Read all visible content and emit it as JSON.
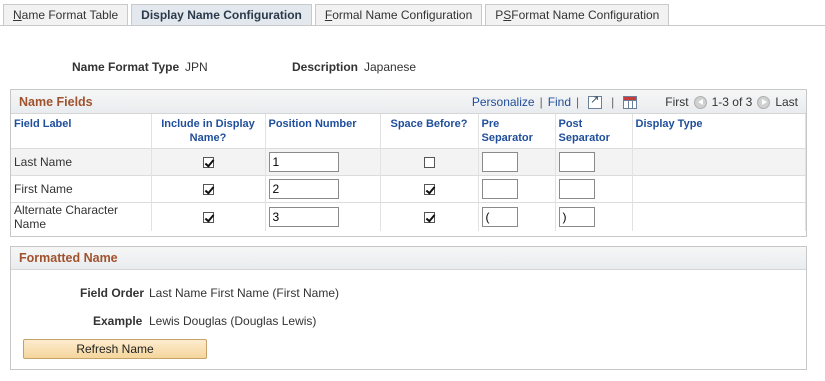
{
  "tabs": [
    {
      "label": "Name Format Table",
      "active": false
    },
    {
      "label": "Display Name Configuration",
      "active": true
    },
    {
      "label": "Formal Name Configuration",
      "active": false
    },
    {
      "label": "PSFormat Name Configuration",
      "active": false
    }
  ],
  "header": {
    "format_type_label": "Name Format Type",
    "format_type_value": "JPN",
    "description_label": "Description",
    "description_value": "Japanese"
  },
  "name_fields": {
    "title": "Name Fields",
    "personalize": "Personalize",
    "separator": "|",
    "find": "Find",
    "first": "First",
    "range": "1-3 of 3",
    "last": "Last",
    "columns": {
      "field_label": "Field Label",
      "include": "Include in Display Name?",
      "position": "Position Number",
      "space": "Space Before?",
      "pre": "Pre Separator",
      "post": "Post Separator",
      "display_type": "Display Type"
    },
    "rows": [
      {
        "label": "Last Name",
        "include": true,
        "position": "1",
        "space_before": false,
        "pre": "",
        "post": "",
        "display_type": ""
      },
      {
        "label": "First Name",
        "include": true,
        "position": "2",
        "space_before": true,
        "pre": "",
        "post": "",
        "display_type": ""
      },
      {
        "label": "Alternate Character Name",
        "include": true,
        "position": "3",
        "space_before": true,
        "pre": "(",
        "post": ")",
        "display_type": ""
      }
    ]
  },
  "formatted_name": {
    "title": "Formatted Name",
    "field_order_label": "Field Order",
    "field_order_value": "Last Name First Name (First Name)",
    "example_label": "Example",
    "example_value": "Lewis Douglas (Douglas Lewis)",
    "refresh_button": "Refresh Name"
  },
  "colors": {
    "section_title": "#a0522d",
    "link": "#1f4e9b",
    "button": "#f5d59b"
  }
}
